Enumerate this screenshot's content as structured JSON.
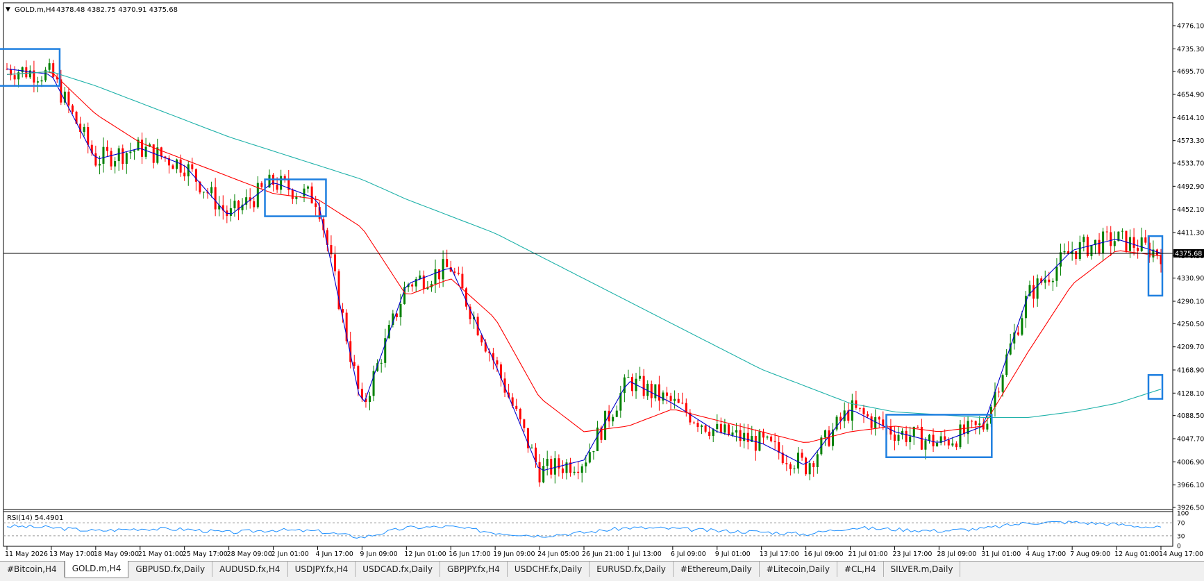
{
  "chart_header": {
    "symbol_label": "GOLD.m,H4",
    "ohlc_text": "4378.48 4382.75 4370.91 4375.68",
    "current_price_label": "4375.68"
  },
  "price_axis": {
    "ticks": [
      "4776.10",
      "4735.30",
      "4695.70",
      "4654.90",
      "4614.10",
      "4573.30",
      "4533.70",
      "4492.90",
      "4452.10",
      "4411.30",
      "4370.50",
      "4330.90",
      "4290.10",
      "4250.50",
      "4209.70",
      "4168.90",
      "4128.10",
      "4088.50",
      "4047.70",
      "4006.90",
      "3966.10",
      "3926.50"
    ]
  },
  "rsi_panel": {
    "label": "RSI(14) 54.4901",
    "levels": [
      "100",
      "70",
      "30",
      "0"
    ]
  },
  "time_axis": {
    "labels": [
      "11 May 2026",
      "13 May 17:00",
      "18 May 09:00",
      "21 May 01:00",
      "25 May 17:00",
      "28 May 09:00",
      "2 Jun 01:00",
      "4 Jun 17:00",
      "9 Jun 09:00",
      "12 Jun 01:00",
      "16 Jun 17:00",
      "19 Jun 09:00",
      "24 Jun 05:00",
      "26 Jun 21:00",
      "1 Jul 13:00",
      "6 Jul 09:00",
      "9 Jul 01:00",
      "13 Jul 17:00",
      "16 Jul 09:00",
      "21 Jul 01:00",
      "23 Jul 17:00",
      "28 Jul 09:00",
      "31 Jul 01:00",
      "4 Aug 17:00",
      "7 Aug 09:00",
      "12 Aug 01:00",
      "14 Aug 17:00"
    ]
  },
  "tabs": [
    {
      "label": "#Bitcoin,H4",
      "active": false
    },
    {
      "label": "GOLD.m,H4",
      "active": true
    },
    {
      "label": "GBPUSD.fx,Daily",
      "active": false
    },
    {
      "label": "AUDUSD.fx,H4",
      "active": false
    },
    {
      "label": "USDJPY.fx,H4",
      "active": false
    },
    {
      "label": "USDCAD.fx,Daily",
      "active": false
    },
    {
      "label": "GBPJPY.fx,H4",
      "active": false
    },
    {
      "label": "USDCHF.fx,Daily",
      "active": false
    },
    {
      "label": "EURUSD.fx,Daily",
      "active": false
    },
    {
      "label": "#Ethereum,Daily",
      "active": false
    },
    {
      "label": "#Litecoin,Daily",
      "active": false
    },
    {
      "label": "#CL,H4",
      "active": false
    },
    {
      "label": "SILVER.m,Daily",
      "active": false
    }
  ],
  "colors": {
    "bull": "#008000",
    "bear": "#ff0000",
    "ma_fast": "#0000cd",
    "ma_mid": "#ff0000",
    "ma_slow": "#20b2aa",
    "rsi": "#1e90ff",
    "box": "#1e7fe0",
    "grid": "#000000"
  },
  "chart_data": {
    "type": "line",
    "title": "GOLD.m,H4",
    "ylim": [
      3926.5,
      4776.1
    ],
    "x": [
      "11 May 2026",
      "13 May 17:00",
      "18 May 09:00",
      "21 May 01:00",
      "25 May 17:00",
      "28 May 09:00",
      "2 Jun 01:00",
      "4 Jun 17:00",
      "9 Jun 09:00",
      "12 Jun 01:00",
      "16 Jun 17:00",
      "19 Jun 09:00",
      "24 Jun 05:00",
      "26 Jun 21:00",
      "1 Jul 13:00",
      "6 Jul 09:00",
      "9 Jul 01:00",
      "13 Jul 17:00",
      "16 Jul 09:00",
      "21 Jul 01:00",
      "23 Jul 17:00",
      "28 Jul 09:00",
      "31 Jul 01:00",
      "4 Aug 17:00",
      "7 Aug 09:00",
      "12 Aug 01:00",
      "14 Aug 17:00"
    ],
    "series": [
      {
        "values": [
          4700,
          4690,
          4540,
          4560,
          4530,
          4440,
          4500,
          4470,
          4100,
          4320,
          4350,
          4180,
          3990,
          4010,
          4150,
          4110,
          4060,
          4040,
          4000,
          4100,
          4060,
          4040,
          4070,
          4300,
          4380,
          4400,
          4375
        ]
      },
      {
        "values": [
          4690,
          4695,
          4620,
          4570,
          4540,
          4510,
          4480,
          4470,
          4420,
          4300,
          4330,
          4260,
          4120,
          4060,
          4070,
          4100,
          4080,
          4060,
          4040,
          4060,
          4070,
          4060,
          4070,
          4200,
          4320,
          4380,
          4370
        ]
      },
      {
        "values": [
          4690,
          4695,
          4670,
          4640,
          4610,
          4580,
          4555,
          4530,
          4505,
          4470,
          4440,
          4410,
          4370,
          4330,
          4290,
          4250,
          4210,
          4170,
          4140,
          4110,
          4095,
          4090,
          4085,
          4085,
          4095,
          4110,
          4135
        ]
      }
    ],
    "rsi_values": [
      60,
      55,
      45,
      52,
      50,
      40,
      48,
      44,
      25,
      55,
      58,
      40,
      30,
      40,
      55,
      52,
      45,
      42,
      35,
      55,
      50,
      45,
      52,
      70,
      72,
      65,
      54.49
    ],
    "annotations": [
      {
        "type": "box",
        "x_from": "11 May 2026",
        "x_to": "13 May 17:00",
        "y_from": 4670,
        "y_to": 4735
      },
      {
        "type": "box",
        "x_from": "2 Jun 01:00",
        "x_to": "4 Jun 17:00",
        "y_from": 4440,
        "y_to": 4505
      },
      {
        "type": "box",
        "x_from": "23 Jul 17:00",
        "x_to": "31 Jul 01:00",
        "y_from": 4015,
        "y_to": 4090
      },
      {
        "type": "box",
        "x_from": "14 Aug 17:00",
        "x_to": "14 Aug 17:00",
        "y_from": 4300,
        "y_to": 4405
      },
      {
        "type": "box",
        "x_from": "14 Aug 17:00",
        "x_to": "14 Aug 17:00",
        "y_from": 4118,
        "y_to": 4160
      }
    ]
  }
}
